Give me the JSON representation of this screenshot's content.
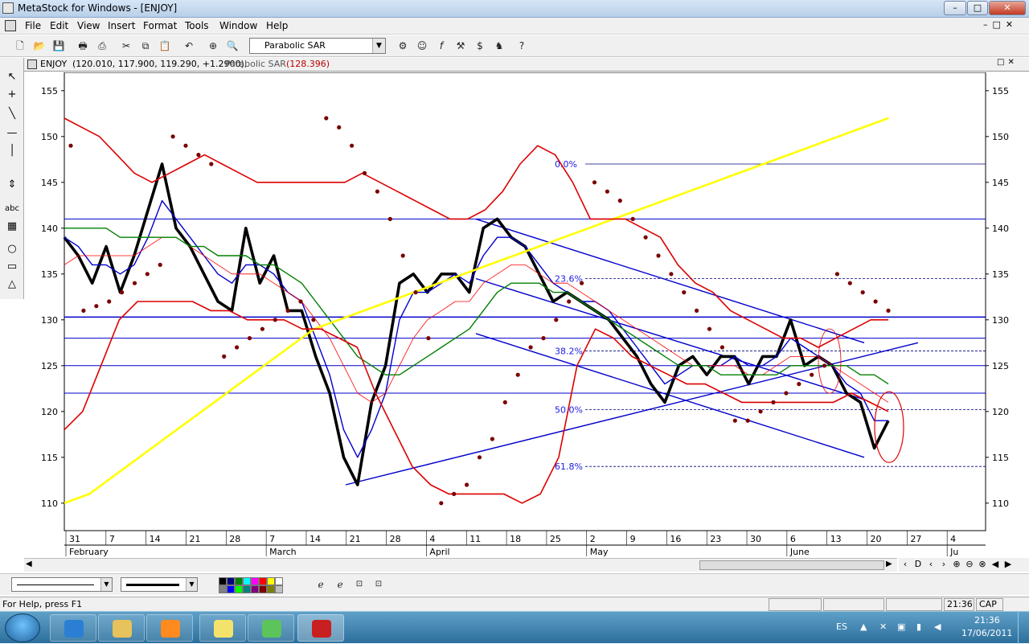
{
  "window": {
    "title": "MetaStock for Windows - [ENJOY]",
    "min": "–",
    "max": "□",
    "close": "✕"
  },
  "menu": [
    "File",
    "Edit",
    "View",
    "Insert",
    "Format",
    "Tools",
    "Window",
    "Help"
  ],
  "toolbar": {
    "indicator_select": "Parabolic SAR"
  },
  "chart_title": {
    "symbol": "ENJOY",
    "ohlc": "(120.010, 117.900, 119.290, +1.2900),",
    "indicator": "Parabolic SAR",
    "indicator_value": "(128.396)"
  },
  "chart_data": {
    "type": "line",
    "title": "ENJOY",
    "ylim": [
      107,
      157
    ],
    "y_ticks": [
      110,
      115,
      120,
      125,
      130,
      135,
      140,
      145,
      150,
      155
    ],
    "day_ticks": [
      "31",
      "7",
      "14",
      "21",
      "28",
      "7",
      "14",
      "21",
      "28",
      "4",
      "11",
      "18",
      "25",
      "2",
      "9",
      "16",
      "23",
      "30",
      "6",
      "13",
      "20",
      "27",
      "4"
    ],
    "month_labels": [
      "February",
      "March",
      "April",
      "May",
      "June",
      "Ju"
    ],
    "fib_levels": [
      {
        "label": "0.0%",
        "value": 147
      },
      {
        "label": "23.6%",
        "value": 134.5
      },
      {
        "label": "38.2%",
        "value": 126.6
      },
      {
        "label": "50.0%",
        "value": 120.2
      },
      {
        "label": "61.8%",
        "value": 114
      }
    ],
    "horizontal_lines": [
      141,
      130.3,
      128,
      125,
      122
    ],
    "series": [
      {
        "values": [
          139,
          137,
          134,
          138,
          133,
          137,
          142,
          147,
          140,
          138,
          135,
          132,
          131,
          140,
          134,
          137,
          131,
          131,
          126,
          122,
          115,
          112,
          121,
          125,
          134,
          135,
          133,
          135,
          135,
          133,
          140,
          141,
          139,
          138,
          135,
          132,
          133,
          132,
          131,
          130,
          128,
          126,
          123,
          121,
          125,
          126,
          124,
          126,
          126,
          123,
          126,
          126,
          130,
          125,
          126,
          125,
          122,
          121,
          116,
          119
        ]
      },
      {
        "values": [
          139,
          138,
          136,
          136,
          135,
          136,
          139,
          143,
          141,
          139,
          137,
          135,
          134,
          136,
          136,
          135,
          133,
          132,
          128,
          124,
          118,
          115,
          118,
          122,
          130,
          133,
          133,
          134,
          135,
          134,
          137,
          139,
          139,
          138,
          136,
          134,
          133,
          132,
          132,
          131,
          129,
          127,
          125,
          123,
          124,
          125,
          125,
          125,
          126,
          125,
          125,
          126,
          128,
          127,
          126,
          125,
          123,
          122,
          119,
          119
        ]
      },
      {
        "values": [
          136,
          137,
          137,
          137,
          137,
          137,
          138,
          139,
          139,
          138,
          137,
          136,
          135,
          135,
          135,
          134,
          133,
          132,
          130,
          128,
          125,
          122,
          121,
          122,
          125,
          128,
          130,
          131,
          132,
          132,
          134,
          135,
          136,
          136,
          135,
          134,
          134,
          133,
          132,
          131,
          130,
          129,
          128,
          127,
          126,
          125,
          125,
          125,
          125,
          124,
          124,
          125,
          126,
          126,
          126,
          125,
          124,
          123,
          122,
          121
        ]
      },
      {
        "values": [
          140,
          140,
          140,
          140,
          139,
          139,
          139,
          139,
          139,
          138,
          138,
          137,
          137,
          137,
          136,
          136,
          135,
          134,
          132,
          130,
          128,
          126,
          125,
          124,
          124,
          125,
          126,
          127,
          128,
          129,
          131,
          133,
          134,
          134,
          134,
          133,
          133,
          132,
          131,
          130,
          129,
          128,
          127,
          126,
          125,
          125,
          125,
          124,
          124,
          124,
          124,
          124,
          125,
          125,
          125,
          125,
          125,
          124,
          124,
          123
        ]
      },
      {
        "values": [
          110,
          111,
          113,
          115,
          117,
          119,
          121,
          123,
          125,
          127,
          129,
          130,
          131,
          132,
          133,
          134,
          135,
          136,
          137,
          138,
          139,
          140,
          141,
          142,
          143,
          144,
          145,
          146,
          147,
          148,
          149,
          150,
          151,
          152
        ]
      },
      {
        "values": [
          152,
          151,
          150,
          148,
          146,
          145,
          146,
          147,
          148,
          147,
          146,
          145,
          145,
          145,
          145,
          145,
          145,
          146,
          145,
          144,
          143,
          142,
          141,
          141,
          142,
          144,
          147,
          149,
          148,
          145,
          141,
          141,
          141,
          140,
          139,
          136,
          134,
          133,
          131,
          130,
          129,
          128,
          128,
          127,
          128,
          129,
          130,
          130
        ]
      },
      {
        "values": [
          118,
          120,
          125,
          130,
          132,
          132,
          132,
          132,
          131,
          131,
          130,
          130,
          130,
          129,
          129,
          128,
          127,
          122,
          118,
          114,
          112,
          111,
          111,
          111,
          111,
          110,
          111,
          115,
          125,
          129,
          128,
          126,
          125,
          124,
          123,
          123,
          122,
          121,
          121,
          121,
          121,
          121,
          121,
          122,
          121,
          120
        ]
      }
    ],
    "sar_values": [
      149,
      131,
      131.5,
      132,
      133,
      134,
      135,
      136,
      150,
      149,
      148,
      147,
      126,
      127,
      128,
      129,
      130,
      131,
      132,
      130,
      152,
      151,
      149,
      146,
      144,
      141,
      137,
      133,
      128,
      110,
      111,
      112,
      115,
      117,
      121,
      124,
      127,
      128,
      130,
      132,
      134,
      145,
      144,
      143,
      141,
      139,
      137,
      135,
      133,
      131,
      129,
      127,
      119,
      119,
      120,
      121,
      122,
      123,
      124,
      125,
      135,
      134,
      133,
      132,
      131
    ]
  },
  "draw_toolbar": {
    "swatches": [
      "#000000",
      "#000080",
      "#008000",
      "#00ffff",
      "#ff00ff",
      "#ff0000",
      "#ffff00",
      "#ffffff",
      "#808080",
      "#0000ff",
      "#00ff00",
      "#008080",
      "#800080",
      "#800000",
      "#808000",
      "#c0c0c0"
    ]
  },
  "status": {
    "help": "For Help, press F1",
    "time": "21:36",
    "cap": "CAP"
  },
  "taskbar": {
    "lang": "ES",
    "clock_time": "21:36",
    "clock_date": "17/06/2011"
  },
  "colors": {
    "price": "#000000",
    "ma_fast": "#0000cc",
    "ma_mid": "#008000",
    "ma_slow": "#ff0000",
    "trend_ma": "#ffff00",
    "bands": "#dd0000",
    "sar": "#7a0000",
    "lines": "#0000cc"
  }
}
